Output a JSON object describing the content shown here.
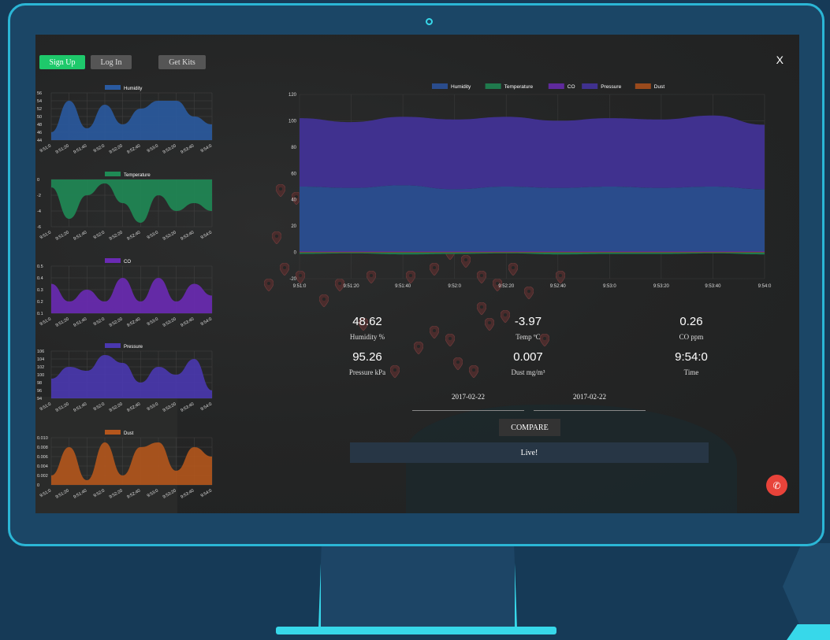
{
  "buttons": {
    "signup": "Sign Up",
    "login": "Log In",
    "kits": "Get Kits",
    "close": "X",
    "compare": "COMPARE",
    "live": "Live!"
  },
  "colors": {
    "humidity": "#2a4c8c",
    "temperature": "#1f7a4d",
    "co": "#5f2a9c",
    "pressure": "#40318f",
    "dust": "#9a4a1c",
    "signup": "#1ec96b",
    "phone": "#e8433a",
    "frame": "#2bb6d6"
  },
  "mini_charts": [
    {
      "legend": "Humidity",
      "color": "#2a5aa0",
      "yticks": [
        "56",
        "54",
        "52",
        "50",
        "48",
        "46",
        "44"
      ]
    },
    {
      "legend": "Temperature",
      "color": "#1f8a55",
      "yticks": [
        "0",
        "-2",
        "-4",
        "-6"
      ]
    },
    {
      "legend": "CO",
      "color": "#6a2ab4",
      "yticks": [
        "0.5",
        "0.4",
        "0.3",
        "0.2",
        "0.1"
      ]
    },
    {
      "legend": "Pressure",
      "color": "#4a38b0",
      "yticks": [
        "106",
        "104",
        "102",
        "100",
        "98",
        "96",
        "94"
      ]
    },
    {
      "legend": "Dust",
      "color": "#b4561c",
      "yticks": [
        "0.010",
        "0.008",
        "0.006",
        "0.004",
        "0.002",
        "0"
      ]
    }
  ],
  "x_ticks": [
    "9:51:0",
    "9:51:20",
    "9:51:40",
    "9:52:0",
    "9:52:20",
    "9:52:40",
    "9:53:0",
    "9:53:20",
    "9:53:40",
    "9:54:0"
  ],
  "chart_data": [
    {
      "type": "area",
      "legend": "Humidity",
      "x": [
        "9:51:0",
        "9:51:20",
        "9:51:40",
        "9:52:0",
        "9:52:20",
        "9:52:40",
        "9:53:0",
        "9:53:20",
        "9:53:40",
        "9:54:0"
      ],
      "values": [
        46,
        54,
        47,
        53,
        48,
        52,
        54,
        54,
        50,
        48
      ],
      "ylim": [
        44,
        56
      ]
    },
    {
      "type": "area",
      "legend": "Temperature",
      "x": [
        "9:51:0",
        "9:51:20",
        "9:51:40",
        "9:52:0",
        "9:52:20",
        "9:52:40",
        "9:53:0",
        "9:53:20",
        "9:53:40",
        "9:54:0"
      ],
      "values": [
        -1,
        -5,
        -2,
        -0.5,
        -3,
        -5.5,
        -2,
        -4,
        -3,
        -4
      ],
      "ylim": [
        -6,
        0
      ]
    },
    {
      "type": "area",
      "legend": "CO",
      "x": [
        "9:51:0",
        "9:51:20",
        "9:51:40",
        "9:52:0",
        "9:52:20",
        "9:52:40",
        "9:53:0",
        "9:53:20",
        "9:53:40",
        "9:54:0"
      ],
      "values": [
        0.35,
        0.2,
        0.3,
        0.2,
        0.4,
        0.2,
        0.4,
        0.2,
        0.35,
        0.25
      ],
      "ylim": [
        0.1,
        0.5
      ]
    },
    {
      "type": "area",
      "legend": "Pressure",
      "x": [
        "9:51:0",
        "9:51:20",
        "9:51:40",
        "9:52:0",
        "9:52:20",
        "9:52:40",
        "9:53:0",
        "9:53:20",
        "9:53:40",
        "9:54:0"
      ],
      "values": [
        99,
        102,
        101,
        105,
        103,
        98,
        102,
        100,
        104,
        96
      ],
      "ylim": [
        94,
        106
      ]
    },
    {
      "type": "area",
      "legend": "Dust",
      "x": [
        "9:51:0",
        "9:51:20",
        "9:51:40",
        "9:52:0",
        "9:52:20",
        "9:52:40",
        "9:53:0",
        "9:53:20",
        "9:53:40",
        "9:54:0"
      ],
      "values": [
        0.002,
        0.008,
        0.001,
        0.009,
        0.002,
        0.008,
        0.009,
        0.003,
        0.008,
        0.006
      ],
      "ylim": [
        0,
        0.01
      ]
    },
    {
      "type": "area",
      "legends": [
        "Humidity",
        "Temperature",
        "CO",
        "Pressure",
        "Dust"
      ],
      "x": [
        "9:51:0",
        "9:51:20",
        "9:51:40",
        "9:52:0",
        "9:52:20",
        "9:52:40",
        "9:53:0",
        "9:53:20",
        "9:53:40",
        "9:54:0"
      ],
      "series": [
        {
          "name": "Humidity",
          "values": [
            50,
            49,
            51,
            48,
            50,
            49,
            50,
            49,
            50,
            48
          ]
        },
        {
          "name": "Temperature",
          "values": [
            -3,
            -2,
            -4,
            -3,
            -2,
            -4,
            -3,
            -3,
            -2,
            -4
          ]
        },
        {
          "name": "CO",
          "values": [
            0.3,
            0.25,
            0.3,
            0.2,
            0.3,
            0.25,
            0.3,
            0.2,
            0.3,
            0.25
          ]
        },
        {
          "name": "Pressure",
          "values": [
            102,
            99,
            103,
            101,
            103,
            100,
            102,
            101,
            104,
            97
          ]
        },
        {
          "name": "Dust",
          "values": [
            0.006,
            0.005,
            0.007,
            0.004,
            0.006,
            0.005,
            0.006,
            0.004,
            0.006,
            0.005
          ]
        }
      ],
      "ylim": [
        -20,
        120
      ],
      "yticks": [
        "120",
        "100",
        "80",
        "60",
        "40",
        "20",
        "0",
        "-20"
      ]
    }
  ],
  "stats": {
    "humidity_val": "48.62",
    "humidity_lbl": "Humidity %",
    "temp_val": "-3.97",
    "temp_lbl": "Temp ºC",
    "co_val": "0.26",
    "co_lbl": "CO ppm",
    "pressure_val": "95.26",
    "pressure_lbl": "Pressure kPa",
    "dust_val": "0.007",
    "dust_lbl": "Dust mg/m³",
    "time_val": "9:54:0",
    "time_lbl": "Time"
  },
  "dates": {
    "from": "2017-02-22",
    "to": "2017-02-22"
  }
}
